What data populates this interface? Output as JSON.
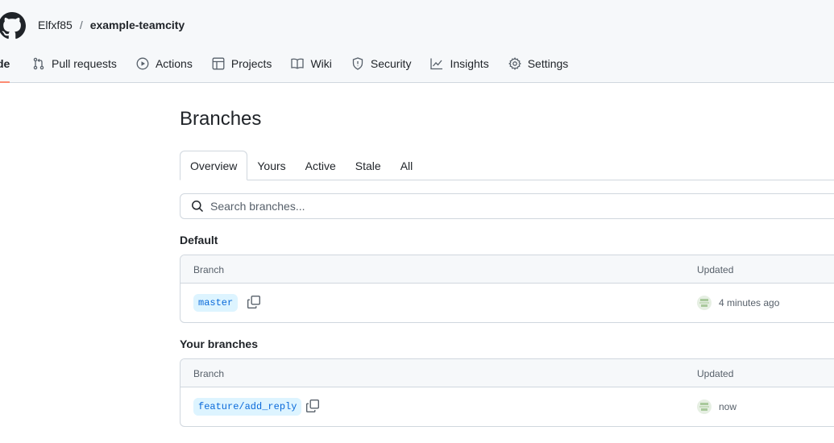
{
  "repo": {
    "owner": "Elfxf85",
    "separator": "/",
    "name": "example-teamcity"
  },
  "nav": {
    "code_label": "de",
    "items": [
      {
        "label": "Pull requests",
        "icon": "pull-request-icon"
      },
      {
        "label": "Actions",
        "icon": "play-icon"
      },
      {
        "label": "Projects",
        "icon": "table-icon"
      },
      {
        "label": "Wiki",
        "icon": "book-icon"
      },
      {
        "label": "Security",
        "icon": "shield-icon"
      },
      {
        "label": "Insights",
        "icon": "graph-icon"
      },
      {
        "label": "Settings",
        "icon": "gear-icon"
      }
    ]
  },
  "page": {
    "title": "Branches"
  },
  "subtabs": [
    "Overview",
    "Yours",
    "Active",
    "Stale",
    "All"
  ],
  "search": {
    "placeholder": "Search branches..."
  },
  "sections": [
    {
      "title": "Default",
      "columns": [
        "Branch",
        "Updated"
      ],
      "rows": [
        {
          "branch": "master",
          "updated": "4 minutes ago"
        }
      ]
    },
    {
      "title": "Your branches",
      "columns": [
        "Branch",
        "Updated"
      ],
      "rows": [
        {
          "branch": "feature/add_reply",
          "updated": "now"
        }
      ]
    }
  ],
  "colors": {
    "accent_underline": "#fd8c73",
    "branch_bg": "#ddf4ff",
    "branch_text": "#0969da",
    "border": "#d0d7de"
  }
}
